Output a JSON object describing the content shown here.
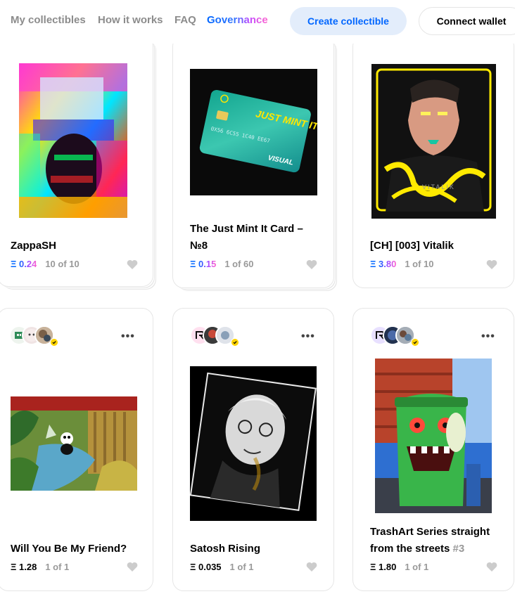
{
  "nav": {
    "my_collectibles": "My collectibles",
    "how_it_works": "How it works",
    "faq": "FAQ",
    "governance": "Governance",
    "create_button": "Create collectible",
    "connect_button": "Connect wallet"
  },
  "currency_symbol": "Ξ",
  "cards": [
    {
      "title": "ZappaSH",
      "edition": "",
      "price": "0.24",
      "count": "10 of 10"
    },
    {
      "title": "The Just Mint It Card – №8",
      "edition": "",
      "price": "0.15",
      "count": "1 of 60"
    },
    {
      "title": "[CH] [003] Vitalik",
      "edition": "",
      "price": "3.80",
      "count": "1 of 10"
    },
    {
      "title": "Will You Be My Friend?",
      "edition": "",
      "price": "1.28",
      "count": "1 of 1"
    },
    {
      "title": "Satosh Rising",
      "edition": "",
      "price": "0.035",
      "count": "1 of 1"
    },
    {
      "title": "TrashArt Series straight from the streets",
      "edition": "#3",
      "price": "1.80",
      "count": "1 of 1"
    }
  ],
  "card_art_text": {
    "card2_brand": "JUST MINT IT",
    "card2_number": "0X56 6C55 1C40 EE67",
    "card2_visual": "VISUAL",
    "card3_sign": "VITALIK"
  },
  "colors": {
    "accent": "#0066ff",
    "create_bg": "#e3edfb",
    "muted": "#999999",
    "verified": "#ffd400"
  },
  "icons": {
    "like": "heart-icon",
    "more": "more-dots-icon",
    "verified": "verified-badge-icon"
  }
}
